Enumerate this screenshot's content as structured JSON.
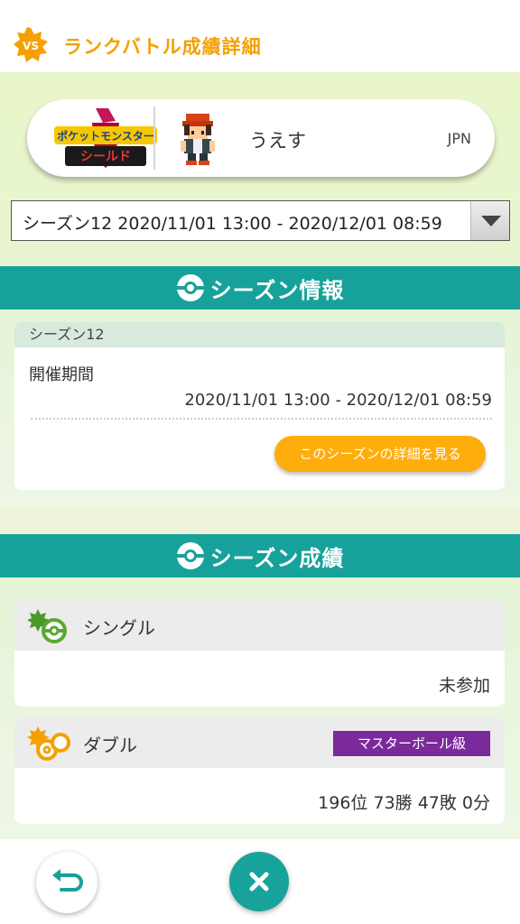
{
  "header": {
    "title": "ランクバトル成績詳細",
    "badge_text": "VS",
    "accent_color": "#f5a000"
  },
  "profile": {
    "game_logo_top": "ポケットモンスター",
    "game_logo_bottom": "シールド",
    "player_name": "うえす",
    "region": "JPN"
  },
  "season_select": {
    "selected": "シーズン12 2020/11/01 13:00 - 2020/12/01 08:59"
  },
  "season_info": {
    "section_title": "シーズン情報",
    "card_title": "シーズン12",
    "period_label": "開催期間",
    "period_value": "2020/11/01 13:00 - 2020/12/01 08:59",
    "detail_button": "このシーズンの詳細を見る"
  },
  "season_results": {
    "section_title": "シーズン成績",
    "single": {
      "title": "シングル",
      "value": "未参加"
    },
    "double": {
      "title": "ダブル",
      "rank_badge": "マスターボール級",
      "value": "196位 73勝 47敗 0分"
    }
  },
  "colors": {
    "teal": "#16a29a",
    "orange": "#ffad0d",
    "purple": "#7a2a9a"
  },
  "icons": {
    "back": "back-arrow-icon",
    "close": "close-icon"
  }
}
